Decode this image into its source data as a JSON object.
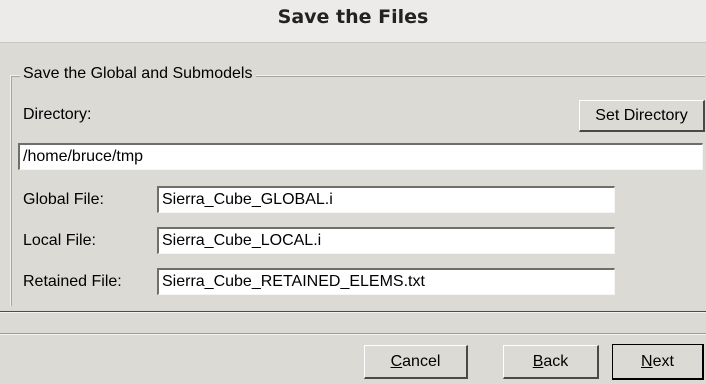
{
  "window": {
    "title": "Save the Files"
  },
  "group": {
    "legend": "Save the Global and Submodels",
    "directory_label": "Directory:",
    "set_directory_button": "Set Directory",
    "directory_value": "/home/bruce/tmp",
    "global_file_label": "Global File:",
    "global_file_value": "Sierra_Cube_GLOBAL.i",
    "local_file_label": "Local File:",
    "local_file_value": "Sierra_Cube_LOCAL.i",
    "retained_file_label": "Retained File:",
    "retained_file_value": "Sierra_Cube_RETAINED_ELEMS.txt"
  },
  "buttons": {
    "cancel_first": "C",
    "cancel_rest": "ancel",
    "back_first": "B",
    "back_rest": "ack",
    "next_first": "N",
    "next_rest": "ext"
  }
}
